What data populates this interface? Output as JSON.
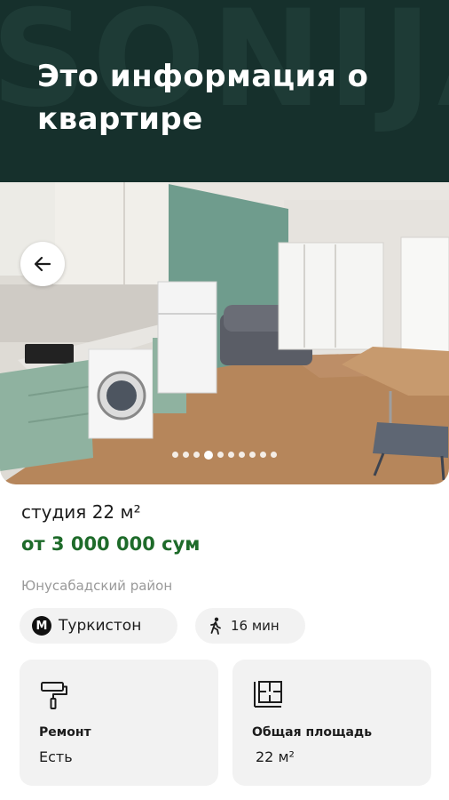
{
  "header": {
    "watermark": "SONIJA",
    "title": "Это информация о квартире"
  },
  "gallery": {
    "photo_count": 10,
    "active_index": 3
  },
  "listing": {
    "title": "студия 22 м²",
    "price": "от 3 000 000 сум",
    "district": "Юнусабадский район",
    "metro": {
      "badge": "M",
      "station": "Туркистон"
    },
    "walk_time": "16 мин"
  },
  "features": [
    {
      "icon": "paint-roller-icon",
      "label": "Ремонт",
      "value": "Есть"
    },
    {
      "icon": "floor-plan-icon",
      "label": "Общая площадь",
      "value": "22 м²"
    }
  ],
  "colors": {
    "header_bg": "#16302c",
    "price": "#1e6b2a",
    "muted": "#9a9a9a",
    "chip_bg": "#f2f2f2"
  }
}
